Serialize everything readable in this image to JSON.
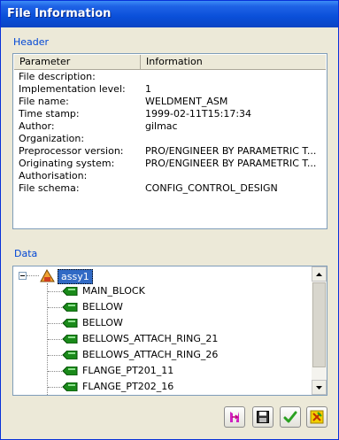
{
  "window": {
    "title": "File Information"
  },
  "header_group": {
    "label": "Header",
    "columns": [
      "Parameter",
      "Information"
    ],
    "rows": [
      {
        "param": "File description:",
        "info": ""
      },
      {
        "param": "Implementation level:",
        "info": "1"
      },
      {
        "param": "File name:",
        "info": "WELDMENT_ASM"
      },
      {
        "param": "Time stamp:",
        "info": "1999-02-11T15:17:34"
      },
      {
        "param": "Author:",
        "info": "gilmac"
      },
      {
        "param": "Organization:",
        "info": ""
      },
      {
        "param": "Preprocessor version:",
        "info": "PRO/ENGINEER BY PARAMETRIC T..."
      },
      {
        "param": "Originating system:",
        "info": "PRO/ENGINEER BY PARAMETRIC T..."
      },
      {
        "param": "Authorisation:",
        "info": ""
      },
      {
        "param": "File schema:",
        "info": "CONFIG_CONTROL_DESIGN"
      }
    ]
  },
  "data_group": {
    "label": "Data",
    "root": {
      "label": "assy1",
      "expanded": true,
      "icon": "assembly-icon"
    },
    "children": [
      {
        "label": "MAIN_BLOCK",
        "icon": "part-icon"
      },
      {
        "label": "BELLOW",
        "icon": "part-icon"
      },
      {
        "label": "BELLOW",
        "icon": "part-icon"
      },
      {
        "label": "BELLOWS_ATTACH_RING_21",
        "icon": "part-icon"
      },
      {
        "label": "BELLOWS_ATTACH_RING_26",
        "icon": "part-icon"
      },
      {
        "label": "FLANGE_PT201_11",
        "icon": "part-icon"
      },
      {
        "label": "FLANGE_PT202_16",
        "icon": "part-icon"
      }
    ]
  },
  "toolbar": {
    "buttons": [
      {
        "name": "convert-button",
        "icon": "convert-icon"
      },
      {
        "name": "save-button",
        "icon": "floppy-disk-icon"
      },
      {
        "name": "ok-button",
        "icon": "checkmark-icon"
      },
      {
        "name": "cancel-button",
        "icon": "cancel-icon"
      }
    ]
  },
  "colors": {
    "accent": "#0046d5",
    "selection": "#316ac5",
    "part_green": "#1a8a1a"
  }
}
